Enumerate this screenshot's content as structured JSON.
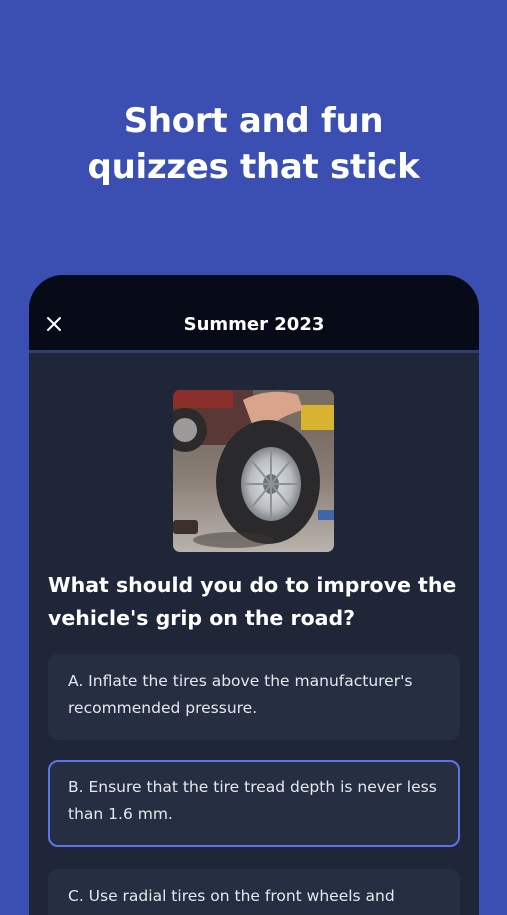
{
  "headline": {
    "line1": "Short and fun",
    "line2": "quizzes that stick"
  },
  "quiz": {
    "title": "Summer 2023",
    "close_icon": "close-icon",
    "image_alt": "Person handling a car tire in a garage",
    "question": "What should you do to improve the vehicle's grip on the road?",
    "answers": [
      {
        "label": "A. Inflate the tires above the manufacturer's recommended pressure."
      },
      {
        "label": "B. Ensure that the tire tread depth is never less than 1.6 mm."
      },
      {
        "label": "C. Use radial tires on the front wheels and"
      }
    ],
    "selected_index": 1
  },
  "colors": {
    "background": "#3a4fb1",
    "card": "#1f2637",
    "header": "#070b18",
    "answer": "#262e41",
    "selected_border": "#5b74e6"
  }
}
